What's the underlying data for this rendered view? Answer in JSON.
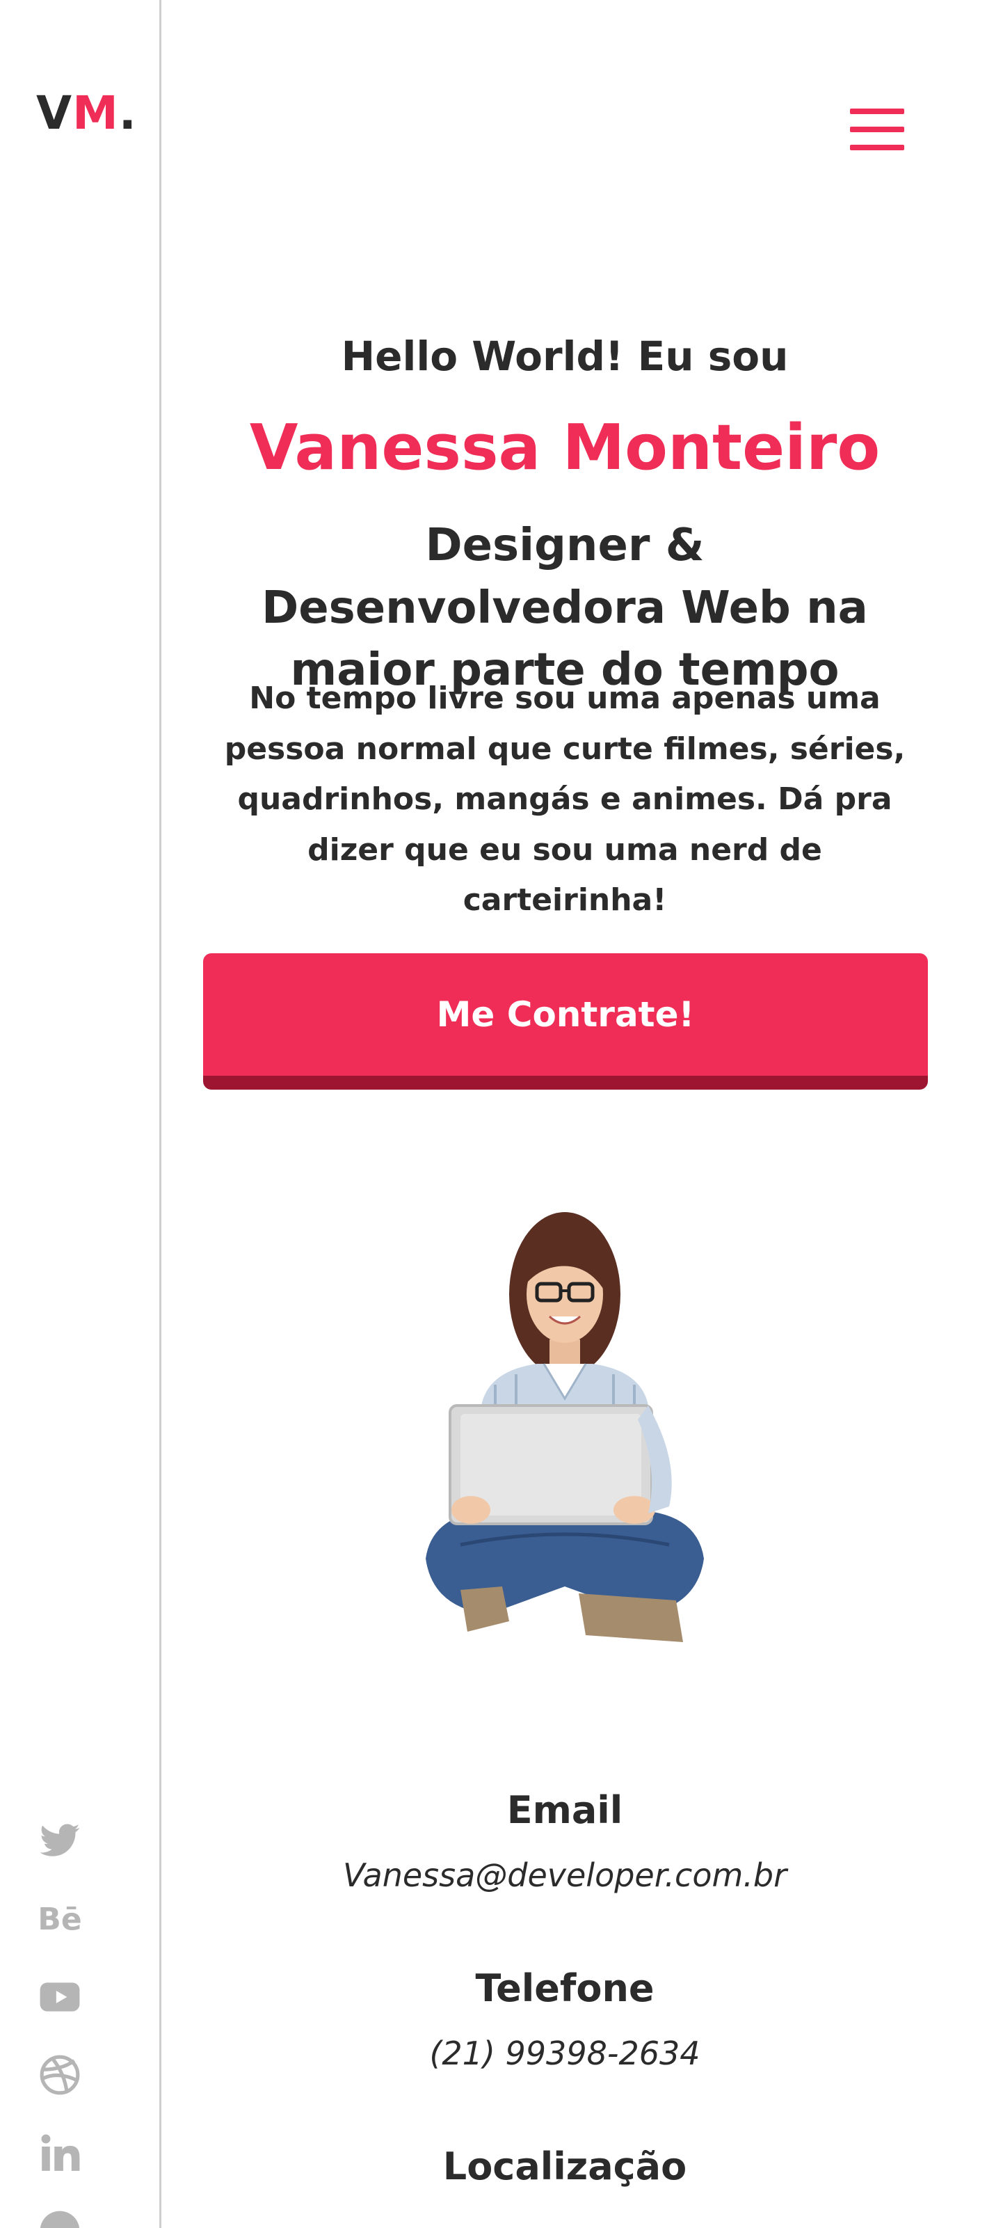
{
  "brand": {
    "logo_prefix": "V",
    "logo_accent": "M",
    "logo_suffix": ".",
    "accent_color": "#ef2d56",
    "dark_color": "#2b2b2b"
  },
  "header": {
    "menu_icon": "hamburger-menu-icon"
  },
  "hero": {
    "greeting": "Hello World! Eu sou",
    "name": "Vanessa Monteiro",
    "role": "Designer & Desenvolvedora Web na maior parte do tempo",
    "bio": "No tempo livre sou uma apenas uma pessoa normal que curte filmes, séries, quadrinhos, mangás e animes. Dá pra dizer que eu sou uma nerd de carteirinha!",
    "cta_label": "Me Contrate!"
  },
  "contact": {
    "email_label": "Email",
    "email_value": "Vanessa@developer.com.br",
    "phone_label": "Telefone",
    "phone_value": "(21) 99398-2634",
    "location_label": "Localização"
  },
  "social": [
    {
      "icon": "twitter-icon"
    },
    {
      "icon": "behance-icon",
      "text": "Bē"
    },
    {
      "icon": "youtube-icon"
    },
    {
      "icon": "dribbble-icon"
    },
    {
      "icon": "linkedin-icon"
    },
    {
      "icon": "github-icon"
    }
  ]
}
